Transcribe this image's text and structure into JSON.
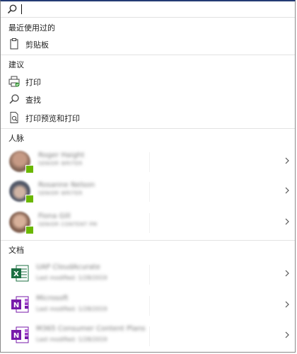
{
  "search": {
    "value": "",
    "placeholder": ""
  },
  "recent": {
    "header": "最近使用过的",
    "items": [
      {
        "label": "剪贴板",
        "icon": "clipboard-icon"
      }
    ]
  },
  "suggestions": {
    "header": "建议",
    "items": [
      {
        "label": "打印",
        "icon": "printer-icon"
      },
      {
        "label": "查找",
        "icon": "search-icon"
      },
      {
        "label": "打印预览和打印",
        "icon": "print-preview-icon"
      }
    ]
  },
  "people": {
    "header": "人脉",
    "items": [
      {
        "name": "Roger Haight",
        "title": "SENIOR WRITER"
      },
      {
        "name": "Rosanne Nelson",
        "title": "SENIOR WRITER"
      },
      {
        "name": "Fiona Gill",
        "title": "SENIOR CONTENT PM"
      }
    ]
  },
  "documents": {
    "header": "文档",
    "items": [
      {
        "name": "UAP CloudAcurate",
        "meta": "Last modified: 1/28/2019",
        "icon": "excel-icon"
      },
      {
        "name": "Microsoft",
        "meta": "Last modified: 1/28/2019",
        "icon": "onenote-icon"
      },
      {
        "name": "M365 Consumer Content Plans",
        "meta": "Last modified: 1/28/2019",
        "icon": "onenote-icon"
      }
    ]
  },
  "colors": {
    "top_border": "#243a73",
    "presence_available": "#6bb700",
    "excel_green": "#1d6f42",
    "onenote_purple": "#7719aa"
  }
}
